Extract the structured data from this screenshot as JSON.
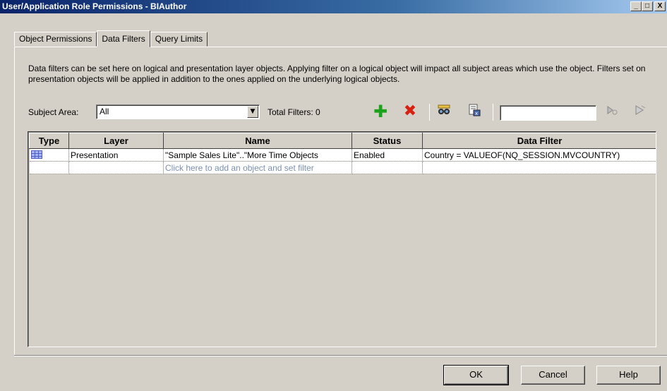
{
  "window": {
    "title": "User/Application Role Permissions - BIAuthor",
    "minimize": "_",
    "maximize": "□",
    "close": "X"
  },
  "tabs": [
    {
      "label": "Object Permissions"
    },
    {
      "label": "Data Filters"
    },
    {
      "label": "Query Limits"
    }
  ],
  "description": "Data filters can be set here on logical and presentation layer objects. Applying filter on a logical object will impact all subject areas which use the object. Filters set on presentation objects will be applied in addition to the ones applied on the underlying logical objects.",
  "toolbar": {
    "subject_area_label": "Subject Area:",
    "subject_area_value": "All",
    "total_filters": "Total Filters: 0",
    "search_value": ""
  },
  "grid": {
    "columns": [
      "Type",
      "Layer",
      "Name",
      "Status",
      "Data Filter"
    ],
    "rows": [
      {
        "layer": "Presentation",
        "name": "\"Sample Sales Lite\"..\"More Time Objects",
        "status": "Enabled",
        "data_filter": "Country = VALUEOF(NQ_SESSION.MVCOUNTRY)"
      }
    ],
    "add_hint": "Click here to add an object and set filter"
  },
  "buttons": {
    "ok": "OK",
    "cancel": "Cancel",
    "help": "Help"
  },
  "colors": {
    "titlebar": "#0a246a",
    "add_icon": "#1aa31a",
    "delete_icon": "#d62010",
    "hint_text": "#7b8fb0"
  }
}
